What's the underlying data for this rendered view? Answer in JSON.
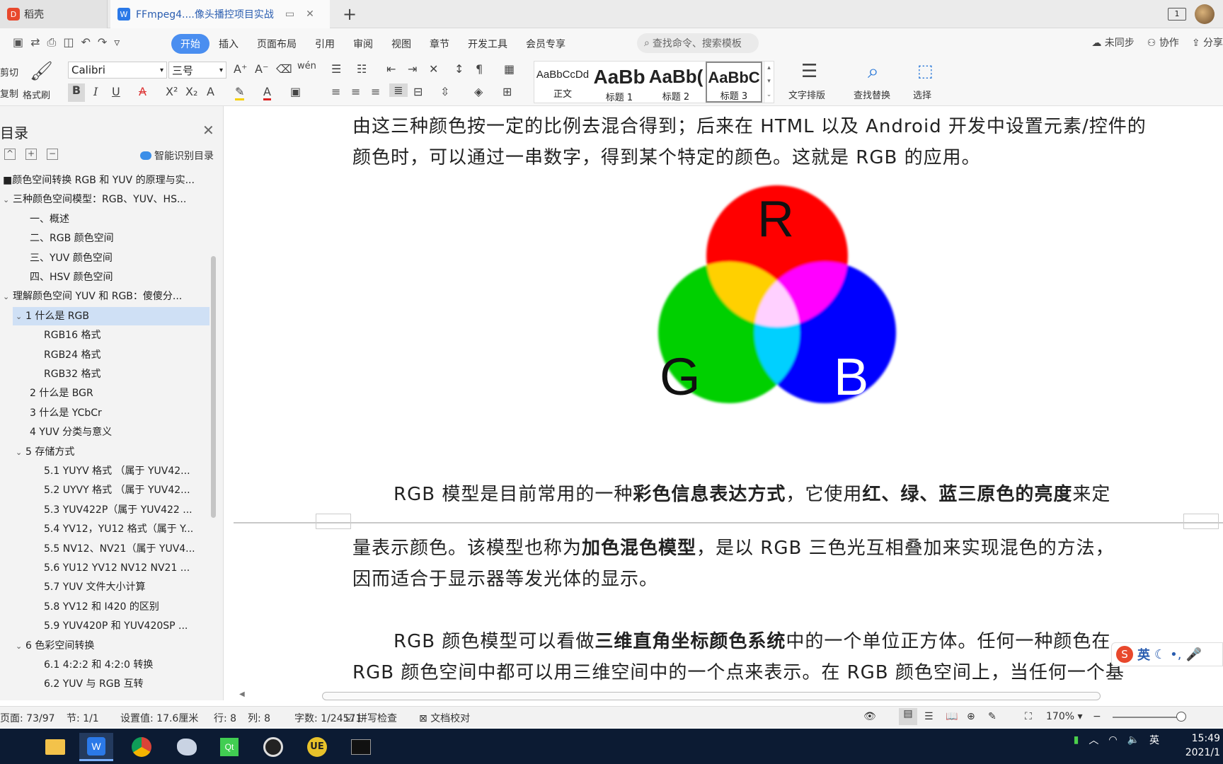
{
  "titlebar": {
    "tab_daoke": "稻壳",
    "tab_doc": "FFmpeg4....像头播控项目实战",
    "new_tab": "+",
    "window_badge": "1"
  },
  "menubar": {
    "items": [
      "开始",
      "插入",
      "页面布局",
      "引用",
      "审阅",
      "视图",
      "章节",
      "开发工具",
      "会员专享"
    ],
    "search_placeholder": "查找命令、搜索模板",
    "right": [
      "未同步",
      "协作",
      "分享"
    ]
  },
  "ribbon": {
    "cut": "剪切",
    "copy": "复制",
    "format_painter": "格式刷",
    "font": "Calibri",
    "size": "三号",
    "styles": [
      {
        "preview": "AaBbCcDd",
        "name": "正文"
      },
      {
        "preview": "AaBb",
        "name": "标题 1"
      },
      {
        "preview": "AaBb(",
        "name": "标题 2"
      },
      {
        "preview": "AaBbC",
        "name": "标题 3"
      }
    ],
    "text_layout": "文字排版",
    "find_replace": "查找替换",
    "select": "选择"
  },
  "sidebar": {
    "title": "目录",
    "smart": "智能识别目录",
    "items": [
      {
        "text": "■颜色空间转换 RGB 和 YUV 的原理与实...",
        "level": 0,
        "chev": ""
      },
      {
        "text": "三种颜色空间模型：RGB、YUV、HS...",
        "level": 0,
        "chev": "v"
      },
      {
        "text": "一、概述",
        "level": 1,
        "chev": ""
      },
      {
        "text": "二、RGB 颜色空间",
        "level": 1,
        "chev": ""
      },
      {
        "text": "三、YUV 颜色空间",
        "level": 1,
        "chev": ""
      },
      {
        "text": "四、HSV 颜色空间",
        "level": 1,
        "chev": ""
      },
      {
        "text": "理解颜色空间 YUV 和 RGB：傻傻分...",
        "level": 0,
        "chev": "v"
      },
      {
        "text": "1 什么是 RGB",
        "level": 1,
        "chev": "v",
        "selected": true
      },
      {
        "text": "RGB16 格式",
        "level": 2,
        "chev": ""
      },
      {
        "text": "RGB24 格式",
        "level": 2,
        "chev": ""
      },
      {
        "text": "RGB32 格式",
        "level": 2,
        "chev": ""
      },
      {
        "text": "2 什么是 BGR",
        "level": 1,
        "chev": ""
      },
      {
        "text": "3 什么是 YCbCr",
        "level": 1,
        "chev": ""
      },
      {
        "text": "4 YUV 分类与意义",
        "level": 1,
        "chev": ""
      },
      {
        "text": "5 存储方式",
        "level": 1,
        "chev": "v"
      },
      {
        "text": "5.1 YUYV 格式 （属于 YUV42...",
        "level": 2,
        "chev": ""
      },
      {
        "text": "5.2 UYVY 格式 （属于 YUV42...",
        "level": 2,
        "chev": ""
      },
      {
        "text": "5.3 YUV422P（属于 YUV422 ...",
        "level": 2,
        "chev": ""
      },
      {
        "text": "5.4 YV12，YU12 格式（属于 Y...",
        "level": 2,
        "chev": ""
      },
      {
        "text": "5.5 NV12、NV21（属于 YUV4...",
        "level": 2,
        "chev": ""
      },
      {
        "text": "5.6 YU12 YV12 NV12 NV21 ...",
        "level": 2,
        "chev": ""
      },
      {
        "text": "5.7 YUV 文件大小计算",
        "level": 2,
        "chev": ""
      },
      {
        "text": "5.8 YV12 和 I420 的区别",
        "level": 2,
        "chev": ""
      },
      {
        "text": "5.9 YUV420P 和 YUV420SP ...",
        "level": 2,
        "chev": ""
      },
      {
        "text": "6 色彩空间转换",
        "level": 1,
        "chev": "v"
      },
      {
        "text": "6.1 4:2:2 和 4:2:0 转换",
        "level": 2,
        "chev": ""
      },
      {
        "text": "6.2 YUV 与 RGB 互转",
        "level": 2,
        "chev": ""
      }
    ]
  },
  "document": {
    "line1": "由这三种颜色按一定的比例去混合得到；后来在 HTML 以及 Android 开发中设置元素/控件的",
    "line2": "颜色时，可以通过一串数字，得到某个特定的颜色。这就是 RGB 的应用。",
    "diagram_labels": {
      "r": "R",
      "g": "G",
      "b": "B"
    },
    "p2": {
      "a": "RGB 模型是目前常用的一种",
      "b": "彩色信息表达方式",
      "c": "，它使用",
      "d": "红、绿、蓝三原色的亮度",
      "e": "来定"
    },
    "p2_line2": {
      "a": "量表示颜色。该模型也称为",
      "b": "加色混色模型",
      "c": "，是以 RGB 三色光互相叠加来实现混色的方法，"
    },
    "p2_line3": "因而适合于显示器等发光体的显示。",
    "p3": {
      "a": "RGB 颜色模型可以看做",
      "b": "三维直角坐标颜色系统",
      "c": "中的一个单位正方体。任何一种颜色在"
    },
    "p3_line2": "RGB 颜色空间中都可以用三维空间中的一个点来表示。在 RGB 颜色空间上，当任何一个基"
  },
  "ime": {
    "lang": "英"
  },
  "status": {
    "page": "页面: 73/97",
    "section": "节: 1/1",
    "setting": "设置值: 17.6厘米",
    "row": "行: 8",
    "col": "列: 8",
    "words": "字数: 1/24571",
    "spell": "拼写检查",
    "proof": "文档校对",
    "zoom": "170%"
  },
  "taskbar": {
    "tray_lang": "英",
    "time": "15:49",
    "date": "2021/1"
  }
}
